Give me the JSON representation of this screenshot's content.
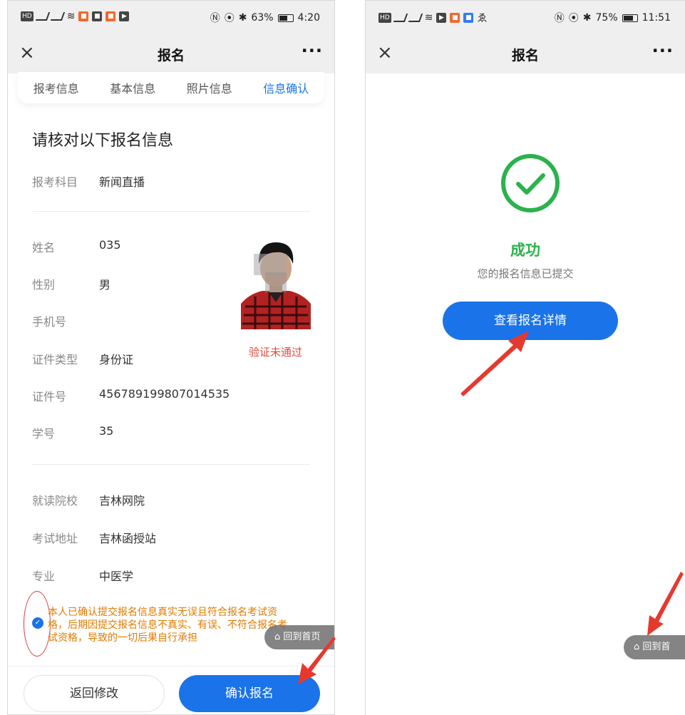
{
  "left_screen": {
    "status": {
      "time": "4:20",
      "battery": "63%",
      "battery_level": 0.63
    },
    "nav": {
      "close": "×",
      "title": "报名",
      "more": "···"
    },
    "steps": [
      "报考信息",
      "基本信息",
      "照片信息",
      "信息确认"
    ],
    "heading": "请核对以下报名信息",
    "exam_subject": {
      "label": "报考科目",
      "value": "新闻直播"
    },
    "personal": [
      {
        "label": "姓名",
        "value": "035"
      },
      {
        "label": "性别",
        "value": "男"
      },
      {
        "label": "手机号",
        "value": ""
      },
      {
        "label": "证件类型",
        "value": "身份证"
      },
      {
        "label": "证件号",
        "value": "456789199807014535"
      },
      {
        "label": "学号",
        "value": "35"
      }
    ],
    "photo_status": "验证未通过",
    "school": [
      {
        "label": "就读院校",
        "value": "吉林网院"
      },
      {
        "label": "考试地址",
        "value": "吉林函授站"
      },
      {
        "label": "专业",
        "value": "中医学"
      }
    ],
    "agreement": "本人已确认提交报名信息真实无误且符合报名考试资格，后期因提交报名信息不真实、有误、不符合报名考试资格，导致的一切后果自行承担",
    "home_float": "回到首页",
    "back_button": "返回修改",
    "confirm_button": "确认报名"
  },
  "right_screen": {
    "status": {
      "time": "11:51",
      "battery": "75%",
      "battery_level": 0.75
    },
    "nav": {
      "close": "×",
      "title": "报名",
      "more": "···"
    },
    "success_title": "成功",
    "success_sub": "您的报名信息已提交",
    "detail_button": "查看报名详情",
    "home_float": "回到首页"
  },
  "colors": {
    "accent": "#1a73e8",
    "success": "#2bb24c",
    "warning": "#e07b00",
    "error": "#e8483c",
    "annotation": "#e03a3a"
  },
  "icons": [
    "close-icon",
    "more-icon",
    "check-circle-icon",
    "home-icon",
    "checkbox-icon"
  ]
}
